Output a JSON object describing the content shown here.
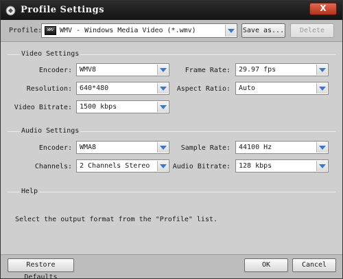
{
  "window": {
    "title": "Profile Settings",
    "close_label": "X"
  },
  "profile": {
    "label": "Profile:",
    "icon_text": "WMV",
    "value": "WMV - Windows Media Video (*.wmv)",
    "save_as_label": "Save as...",
    "delete_label": "Delete"
  },
  "video": {
    "title": "Video Settings",
    "encoder": {
      "label": "Encoder:",
      "value": "WMV8"
    },
    "frame_rate": {
      "label": "Frame Rate:",
      "value": "29.97 fps"
    },
    "resolution": {
      "label": "Resolution:",
      "value": "640*480"
    },
    "aspect_ratio": {
      "label": "Aspect Ratio:",
      "value": "Auto"
    },
    "bitrate": {
      "label": "Video Bitrate:",
      "value": "1500 kbps"
    }
  },
  "audio": {
    "title": "Audio Settings",
    "encoder": {
      "label": "Encoder:",
      "value": "WMA8"
    },
    "sample_rate": {
      "label": "Sample Rate:",
      "value": "44100 Hz"
    },
    "channels": {
      "label": "Channels:",
      "value": "2 Channels Stereo"
    },
    "bitrate": {
      "label": "Audio Bitrate:",
      "value": "128 kbps"
    }
  },
  "help": {
    "title": "Help",
    "text": "Select the output format from the \"Profile\" list."
  },
  "footer": {
    "restore_label": "Restore Defaults",
    "ok_label": "OK",
    "cancel_label": "Cancel"
  },
  "colors": {
    "titlebar": "#1e1e1e",
    "close": "#c8412b",
    "dropdown_arrow": "#3b78c9"
  }
}
